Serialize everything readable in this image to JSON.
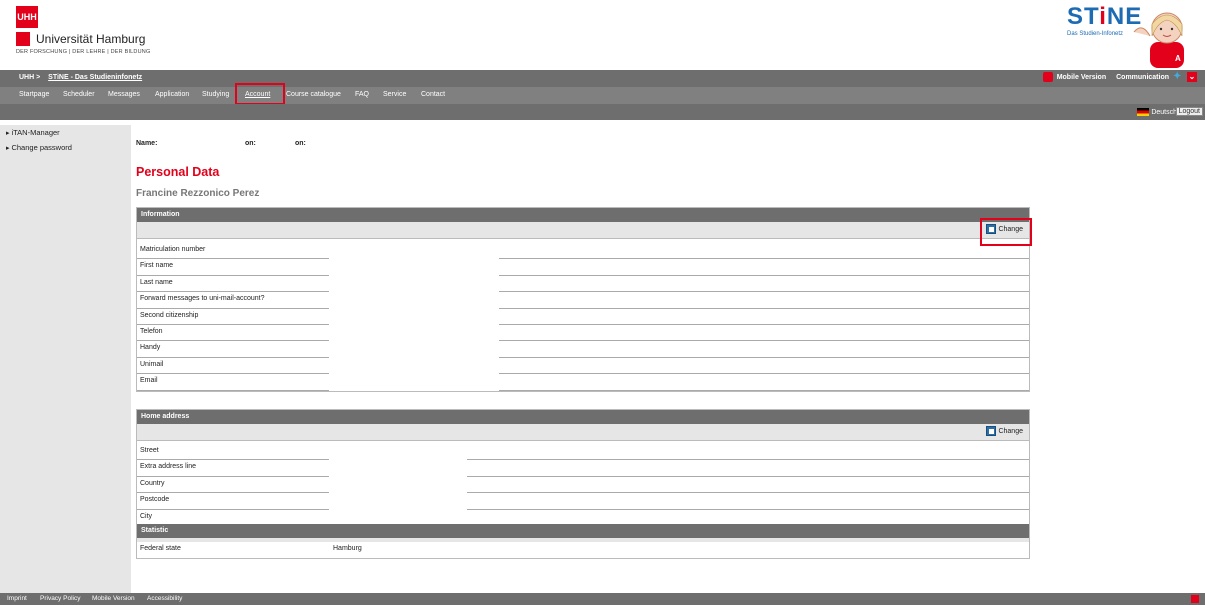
{
  "header": {
    "uhh_logo": "UHH",
    "university": "Universität Hamburg",
    "tagline": "DER FORSCHUNG | DER LEHRE | DER BILDUNG",
    "stine_brand": "STiNE",
    "stine_subtitle": "Das Studien-Infonetz"
  },
  "nav": {
    "crumb_root": "UHH >",
    "crumb_link": "STiNE - Das Studieninfonetz",
    "mobile_version": "Mobile Version",
    "communication": "Communication",
    "menu": [
      "Startpage",
      "Scheduler",
      "Messages",
      "Application",
      "Studying",
      "Account",
      "Course catalogue",
      "FAQ",
      "Service",
      "Contact"
    ],
    "language": "Deutsch",
    "logout": "Logout"
  },
  "sidebar": {
    "items": [
      "iTAN-Manager",
      "Change password"
    ]
  },
  "main": {
    "name_label": "Name:",
    "on_label_1": "on:",
    "on_label_2": "on:",
    "title": "Personal Data",
    "person_name": "Francine Rezzonico Perez",
    "information": {
      "heading": "Information",
      "change_label": "Change",
      "fields": [
        "Matriculation number",
        "First name",
        "Last name",
        "Forward messages to uni-mail-account?",
        "Second citizenship",
        "Telefon",
        "Handy",
        "Unimail",
        "Email"
      ]
    },
    "home_address": {
      "heading": "Home address",
      "change_label": "Change",
      "fields": [
        "Street",
        "Extra address line",
        "Country",
        "Postcode",
        "City"
      ]
    },
    "statistic": {
      "heading": "Statistic",
      "federal_state_label": "Federal state",
      "federal_state_value": "Hamburg"
    }
  },
  "footer": {
    "links": [
      "Imprint",
      "Privacy Policy",
      "Mobile Version",
      "Accessibility"
    ]
  }
}
